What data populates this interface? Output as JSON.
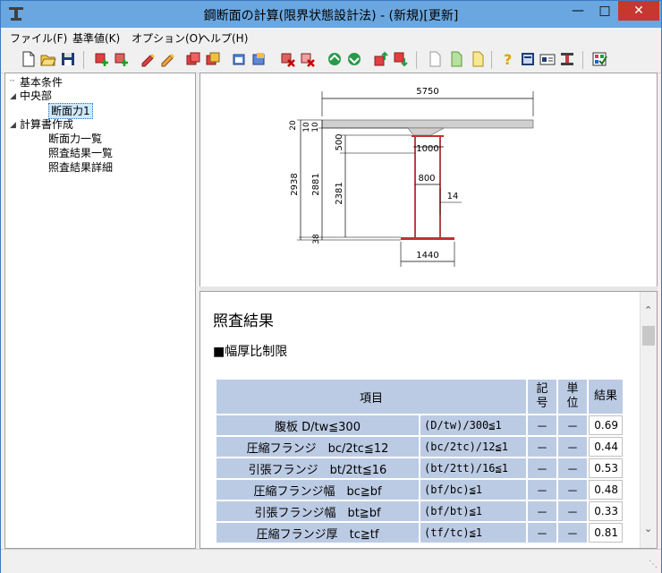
{
  "window": {
    "title": "鋼断面の計算(限界状態設計法) - (新規)[更新]"
  },
  "menu": [
    {
      "label": "ファイル(F)"
    },
    {
      "label": "基準値(K)"
    },
    {
      "label": "オプション(O)"
    },
    {
      "label": "ヘルプ(H)"
    }
  ],
  "tree": {
    "n0": "基本条件",
    "n1": "中央部",
    "n2": "断面力1",
    "n3": "計算書作成",
    "n4": "断面力一覧",
    "n5": "照査結果一覧",
    "n6": "照査結果詳細"
  },
  "drawing": {
    "top_width": "5750",
    "thk_20": "20",
    "thk_10a": "10",
    "thk_10b": "10",
    "thk_500": "500",
    "h_2938": "2938",
    "h_2881": "2881",
    "h_2381": "2381",
    "h_38": "38",
    "w_1000": "1000",
    "w_800": "800",
    "web_14": "14",
    "bottom_1440": "1440"
  },
  "result": {
    "title": "照査結果",
    "section": "■幅厚比制限",
    "headers": {
      "item": "項目",
      "sym": "記号",
      "unit": "単位",
      "result": "結果"
    },
    "rows": [
      {
        "item": "腹板 D/tw≦300",
        "formula": "(D/tw)/300≦1",
        "sym": "－",
        "unit": "－",
        "value": "0.69"
      },
      {
        "item": "圧縮フランジ　bc/2tc≦12",
        "formula": "(bc/2tc)/12≦1",
        "sym": "－",
        "unit": "－",
        "value": "0.44"
      },
      {
        "item": "引張フランジ　bt/2tt≦16",
        "formula": "(bt/2tt)/16≦1",
        "sym": "－",
        "unit": "－",
        "value": "0.53"
      },
      {
        "item": "圧縮フランジ幅　bc≧bf",
        "formula": "(bf/bc)≦1",
        "sym": "－",
        "unit": "－",
        "value": "0.48"
      },
      {
        "item": "引張フランジ幅　bt≧bf",
        "formula": "(bf/bt)≦1",
        "sym": "－",
        "unit": "－",
        "value": "0.33"
      },
      {
        "item": "圧縮フランジ厚　tc≧tf",
        "formula": "(tf/tc)≦1",
        "sym": "－",
        "unit": "－",
        "value": "0.81"
      }
    ]
  }
}
